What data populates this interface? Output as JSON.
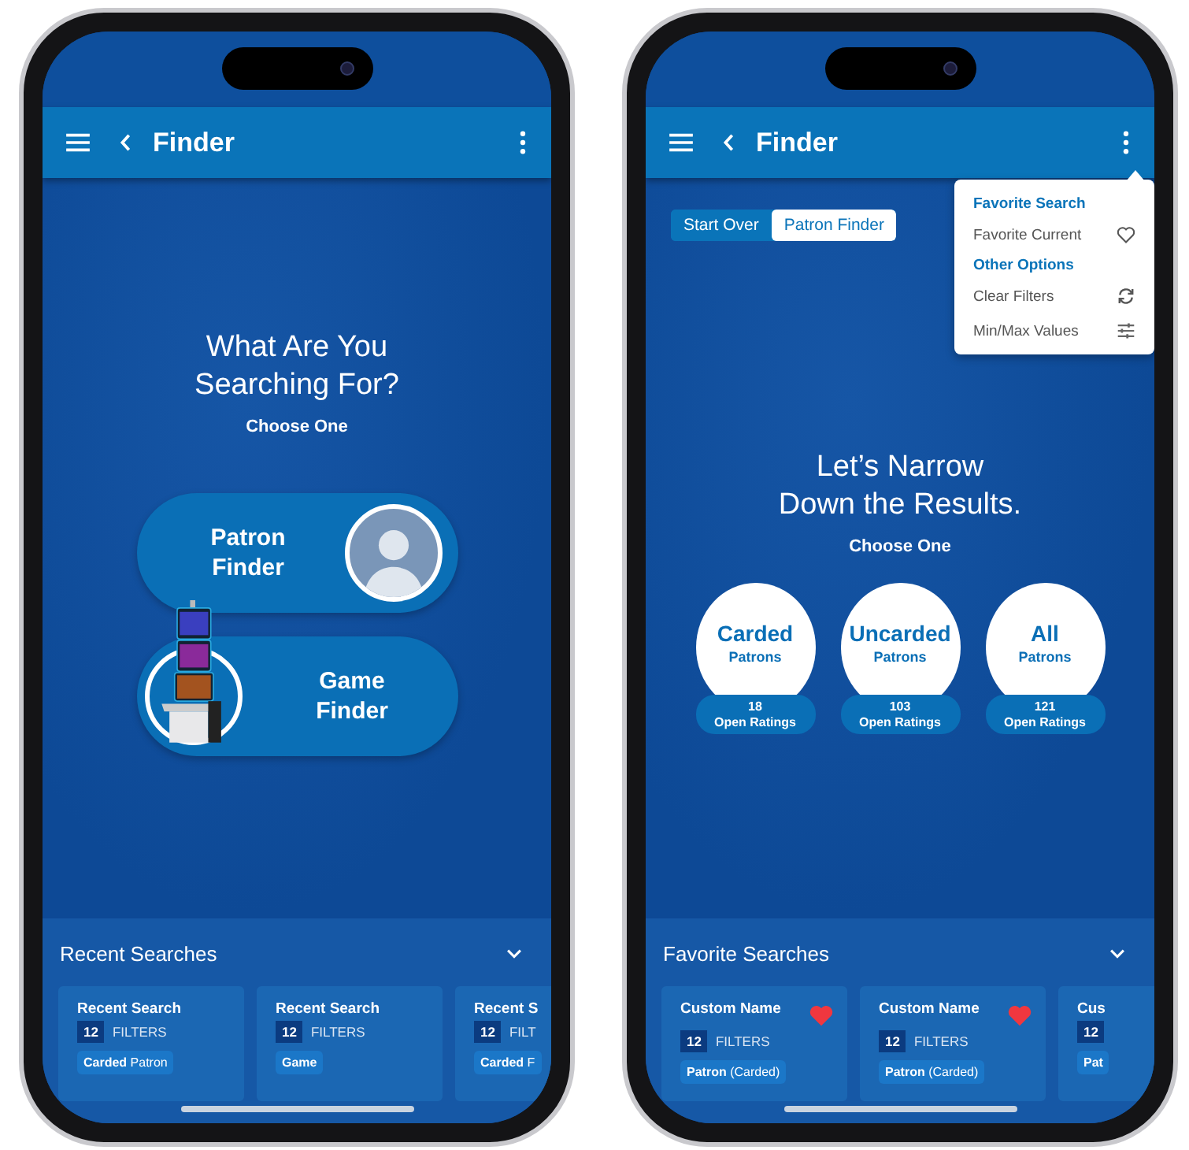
{
  "phones": [
    {
      "kind": "choose",
      "header": {
        "title": "Finder"
      },
      "heading": "What Are You Searching For?",
      "subheading": "Choose One",
      "options": [
        {
          "kind": "patron",
          "label": "Patron Finder"
        },
        {
          "kind": "game",
          "label": "Game Finder"
        }
      ],
      "section": {
        "title": "Recent Searches",
        "cards": [
          {
            "title": "Recent Search",
            "count": "12",
            "filters_label": "FILTERS",
            "tag": "**Carded** Patron",
            "favorite": false
          },
          {
            "title": "Recent Search",
            "count": "12",
            "filters_label": "FILTERS",
            "tag": "**Game**",
            "favorite": false
          },
          {
            "title": "Recent S",
            "count": "12",
            "filters_label": "FILT",
            "tag": "**Carded** F",
            "favorite": false
          }
        ]
      }
    },
    {
      "kind": "narrow",
      "header": {
        "title": "Finder"
      },
      "breadcrumbs": [
        {
          "label": "Start Over",
          "selected": false
        },
        {
          "label": "Patron Finder",
          "selected": true
        }
      ],
      "menu": [
        {
          "kind": "heading",
          "label": "Favorite Search"
        },
        {
          "kind": "option",
          "label": "Favorite Current"
        },
        {
          "kind": "heading",
          "label": "Other Options"
        },
        {
          "kind": "option",
          "label": "Clear Filters"
        },
        {
          "kind": "option",
          "label": "Min/Max Values"
        }
      ],
      "heading": "Let’s Narrow Down the Results.",
      "subheading": "Choose One",
      "segments": [
        {
          "title": "Carded",
          "subtitle": "Patrons",
          "count": "18",
          "count_label": "Open Ratings"
        },
        {
          "title": "Uncarded",
          "subtitle": "Patrons",
          "count": "103",
          "count_label": "Open Ratings"
        },
        {
          "title": "All",
          "subtitle": "Patrons",
          "count": "121",
          "count_label": "Open Ratings"
        }
      ],
      "section": {
        "title": "Favorite Searches",
        "cards": [
          {
            "title": "Custom Name",
            "count": "12",
            "filters_label": "FILTERS",
            "tag": "**Patron** (Carded)",
            "favorite": true
          },
          {
            "title": "Custom Name",
            "count": "12",
            "filters_label": "FILTERS",
            "tag": "**Patron** (Carded)",
            "favorite": true
          },
          {
            "title": "Cus",
            "count": "12",
            "tag": "**Pat**",
            "favorite": false
          }
        ]
      }
    }
  ]
}
